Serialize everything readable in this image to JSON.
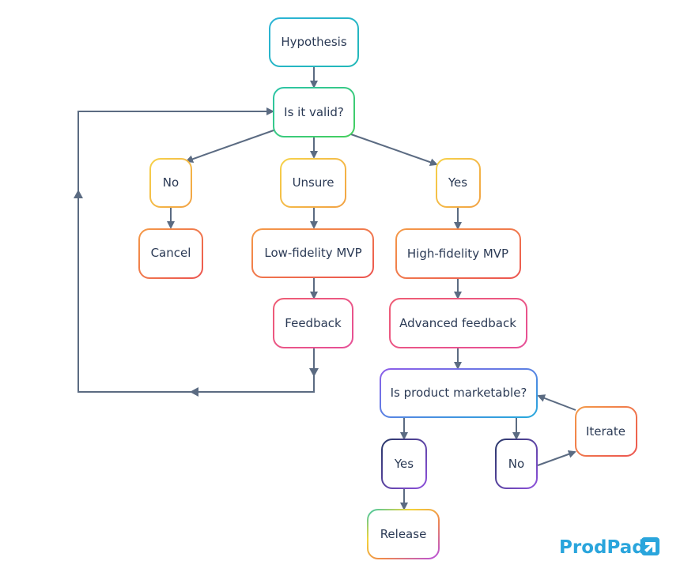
{
  "nodes": {
    "hypothesis": "Hypothesis",
    "is_valid": "Is it valid?",
    "no": "No",
    "unsure": "Unsure",
    "yes": "Yes",
    "cancel": "Cancel",
    "low_mvp": "Low-fidelity MVP",
    "high_mvp": "High-fidelity MVP",
    "feedback": "Feedback",
    "advanced_feedback": "Advanced feedback",
    "marketable": "Is product marketable?",
    "yes2": "Yes",
    "no2": "No",
    "iterate": "Iterate",
    "release": "Release"
  },
  "logo": {
    "text": "ProdPad",
    "color": "#2aa5dc"
  },
  "colors": {
    "edge": "#5b6b82",
    "text": "#2b3a55"
  }
}
